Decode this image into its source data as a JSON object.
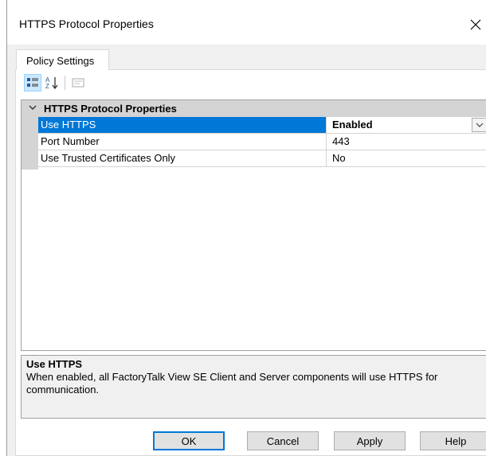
{
  "window": {
    "title": "HTTPS Protocol Properties"
  },
  "tabs": [
    {
      "label": "Policy Settings",
      "active": true
    }
  ],
  "toolbar": {
    "buttons": [
      {
        "icon": "categorized-icon",
        "pressed": true
      },
      {
        "icon": "sort-alphabetical-icon",
        "pressed": false
      },
      {
        "icon": "property-pages-icon",
        "pressed": false,
        "disabled": true
      }
    ]
  },
  "property_grid": {
    "category": "HTTPS Protocol Properties",
    "properties": [
      {
        "name": "Use HTTPS",
        "value": "Enabled",
        "selected": true
      },
      {
        "name": "Port Number",
        "value": "443",
        "selected": false
      },
      {
        "name": "Use Trusted Certificates Only",
        "value": "No",
        "selected": false
      }
    ]
  },
  "description": {
    "title": "Use HTTPS",
    "text": "When enabled, all FactoryTalk View SE Client and Server components will use HTTPS for communication."
  },
  "buttons": {
    "ok": "OK",
    "cancel": "Cancel",
    "apply": "Apply",
    "help": "Help"
  },
  "colors": {
    "selection": "#0078d7",
    "category_bg": "#d4d4d4",
    "dialog_bg": "#f0f0f0"
  }
}
